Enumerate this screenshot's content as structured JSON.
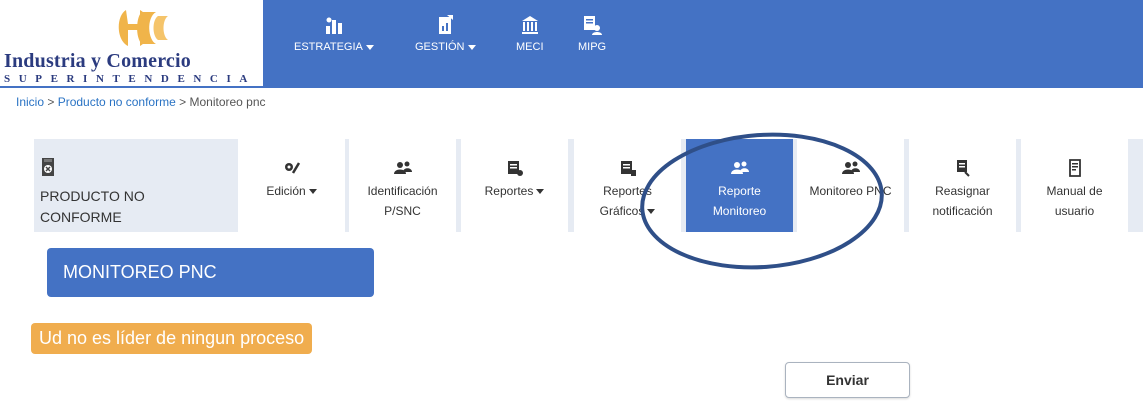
{
  "logo": {
    "name": "Industria y Comercio",
    "subtitle": "SUPERINTENDENCIA"
  },
  "topnav": [
    {
      "label": "ESTRATEGIA",
      "has_caret": true,
      "icon": "chart-building-icon"
    },
    {
      "label": "GESTIÓN",
      "has_caret": true,
      "icon": "document-chart-icon"
    },
    {
      "label": "MECI",
      "has_caret": false,
      "icon": "institution-icon"
    },
    {
      "label": "MIPG",
      "has_caret": false,
      "icon": "document-person-icon"
    }
  ],
  "breadcrumb": {
    "items": [
      "Inicio",
      "Producto no conforme",
      "Monitoreo pnc"
    ],
    "separator": ">"
  },
  "module": {
    "title_line1": "PRODUCTO NO",
    "title_line2": "CONFORME",
    "icon": "sd-card-x-icon"
  },
  "menu_tabs": [
    {
      "line1": "Edición",
      "line2": "",
      "has_caret": true,
      "icon": "tools-icon",
      "active": false
    },
    {
      "line1": "Identificación",
      "line2": "P/SNC",
      "has_caret": false,
      "icon": "people-icon",
      "active": false
    },
    {
      "line1": "Reportes",
      "line2": "",
      "has_caret": true,
      "icon": "report-icon",
      "active": false
    },
    {
      "line1": "Reportes",
      "line2": "Gráficos",
      "has_caret": true,
      "icon": "report-chart-icon",
      "active": false
    },
    {
      "line1": "Reporte",
      "line2": "Monitoreo",
      "has_caret": false,
      "icon": "people-icon",
      "active": true
    },
    {
      "line1": "Monitoreo PNC",
      "line2": "",
      "has_caret": false,
      "icon": "people-icon",
      "active": false
    },
    {
      "line1": "Reasignar",
      "line2": "notificación",
      "has_caret": false,
      "icon": "document-search-icon",
      "active": false
    },
    {
      "line1": "Manual de",
      "line2": "usuario",
      "has_caret": false,
      "icon": "manual-icon",
      "active": false
    }
  ],
  "panel_title": "MONITOREO PNC",
  "warning": "Ud no es líder de ningun proceso",
  "send_button": "Enviar",
  "colors": {
    "primary": "#4472c4",
    "strip": "#e6ebf3",
    "warning": "#f0ad4e",
    "annotation": "#2f4f88",
    "logo_text": "#2b3b7f",
    "logo_gold": "#f0b44a"
  }
}
